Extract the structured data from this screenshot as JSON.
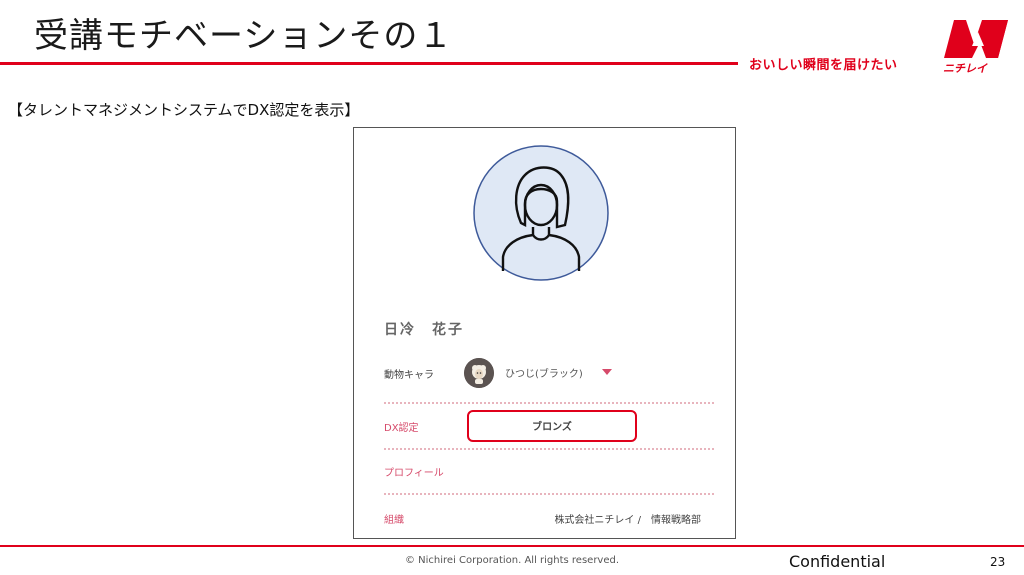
{
  "slide": {
    "title": "受講モチベーションその１",
    "slogan": "おいしい瞬間を届けたい",
    "logo_text": "ニチレイ",
    "section_heading": "【タレントマネジメントシステムでDX認定を表示】"
  },
  "profile": {
    "name": "日冷　花子",
    "character_label": "動物キャラ",
    "character_value": "ひつじ(ブラック)",
    "dx_label": "DX認定",
    "dx_value": "ブロンズ",
    "profile_label": "プロフィール",
    "org_label": "組織",
    "org_value": "株式会社ニチレイ /　情報戦略部"
  },
  "footer": {
    "copyright": "© Nichirei Corporation. All rights reserved.",
    "confidential": "Confidential",
    "page_number": "23"
  },
  "colors": {
    "brand_red": "#e0001b",
    "label_pink": "#d64a6a",
    "avatar_fill": "#dfe8f5"
  },
  "icons": {
    "avatar": "person-avatar-icon",
    "character": "sheep-icon",
    "dropdown": "caret-down-icon",
    "logo": "nichirei-logo-icon"
  }
}
